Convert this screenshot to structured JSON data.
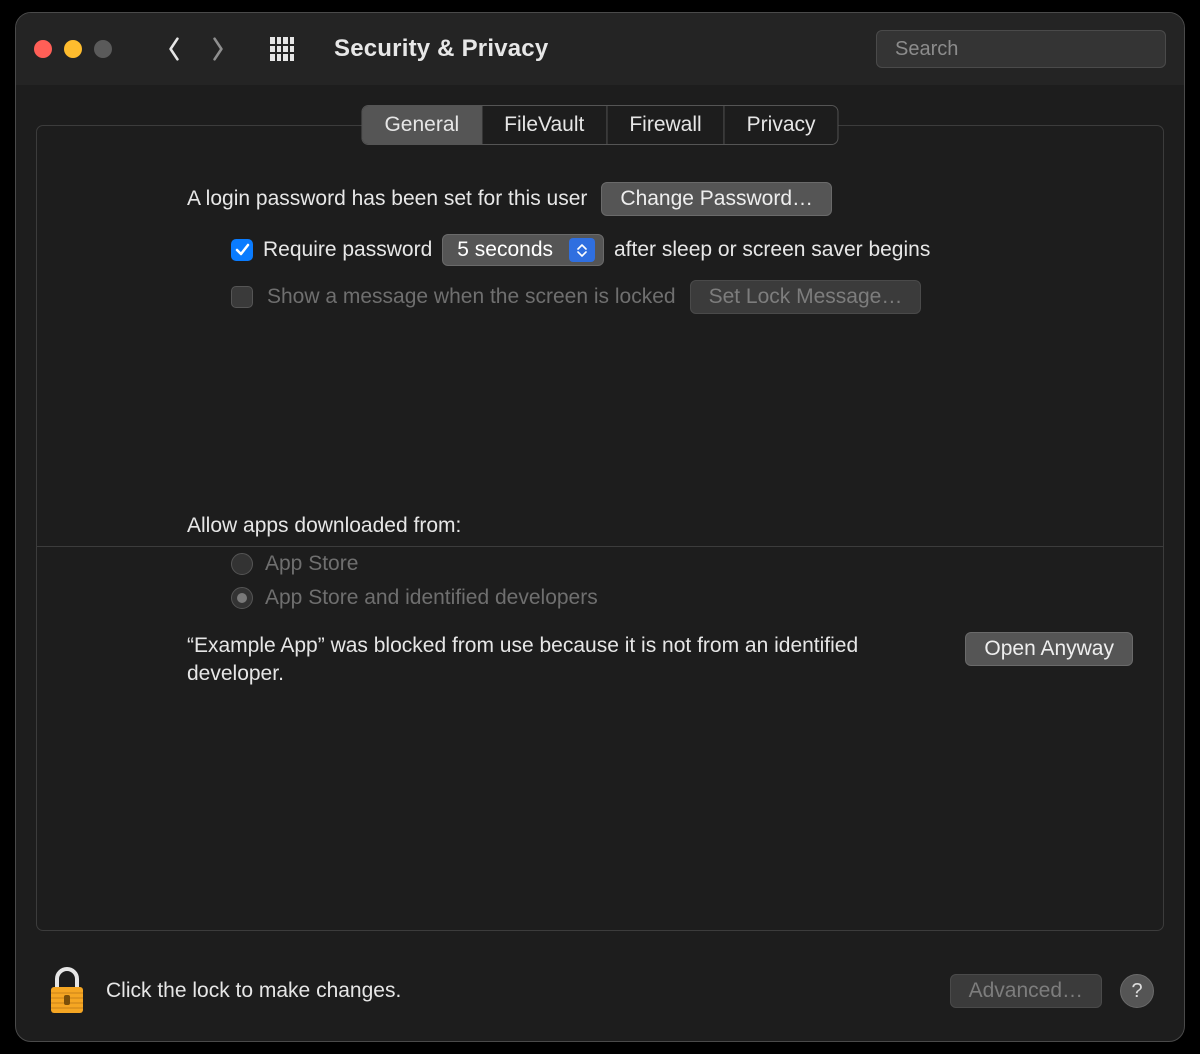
{
  "toolbar": {
    "title": "Security & Privacy",
    "search_placeholder": "Search"
  },
  "tabs": {
    "general": "General",
    "filevault": "FileVault",
    "firewall": "Firewall",
    "privacy": "Privacy"
  },
  "login": {
    "password_set_text": "A login password has been set for this user",
    "change_password_button": "Change Password…",
    "require_password_label": "Require password",
    "require_password_delay": "5 seconds",
    "after_sleep_text": "after sleep or screen saver begins",
    "show_message_label": "Show a message when the screen is locked",
    "set_lock_message_button": "Set Lock Message…"
  },
  "allow_apps": {
    "heading": "Allow apps downloaded from:",
    "option_appstore": "App Store",
    "option_identified": "App Store and identified developers",
    "blocked_message": "“Example App” was blocked from use because it is not from an identified developer.",
    "open_anyway_button": "Open Anyway"
  },
  "footer": {
    "lock_text": "Click the lock to make changes.",
    "advanced_button": "Advanced…",
    "help_label": "?"
  }
}
